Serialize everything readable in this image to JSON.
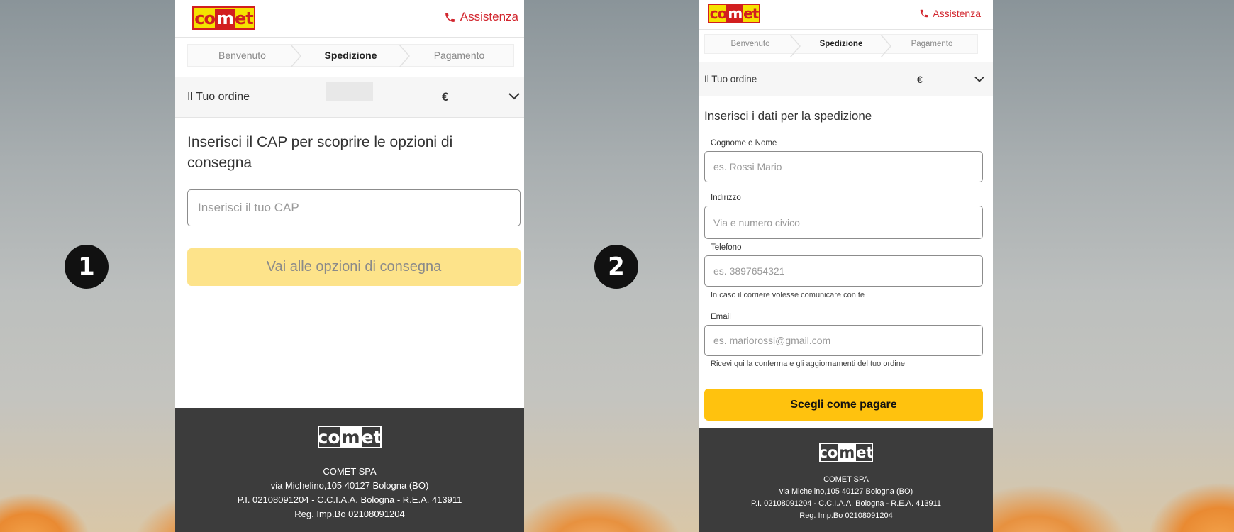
{
  "badges": [
    "1",
    "2"
  ],
  "logo": {
    "prefix": "co",
    "mid": "m",
    "suffix": "et"
  },
  "colors": {
    "brand_red": "#d21f1f",
    "brand_yellow": "#ffc20e",
    "footer_bg": "#3c3c3c"
  },
  "header": {
    "assist_label": "Assistenza",
    "assist_icon": "phone-icon"
  },
  "steps": [
    "Benvenuto",
    "Spedizione",
    "Pagamento"
  ],
  "order": {
    "label": "Il Tuo ordine",
    "currency": "€",
    "toggle_icon": "chevron-down-icon"
  },
  "screen1": {
    "heading": "Inserisci il CAP per scoprire le opzioni di consegna",
    "cap_placeholder": "Inserisci il tuo CAP",
    "button": "Vai alle opzioni di consegna"
  },
  "screen2": {
    "heading": "Inserisci i dati per la spedizione",
    "fields": [
      {
        "label": "Cognome e Nome",
        "placeholder": "es. Rossi Mario",
        "hint": ""
      },
      {
        "label": "Indirizzo",
        "placeholder": "Via e numero civico",
        "hint": ""
      },
      {
        "label": "Telefono",
        "placeholder": "es. 3897654321",
        "hint": "In caso il corriere volesse comunicare con te"
      },
      {
        "label": "Email",
        "placeholder": "es. mariorossi@gmail.com",
        "hint": "Ricevi qui la conferma e gli aggiornamenti del tuo ordine"
      }
    ],
    "button": "Scegli come pagare"
  },
  "footer": {
    "company": "COMET SPA",
    "address": "via Michelino,105 40127 Bologna (BO)",
    "vat": "P.I. 02108091204 - C.C.I.A.A. Bologna - R.E.A. 413911",
    "reg": "Reg. Imp.Bo 02108091204"
  }
}
